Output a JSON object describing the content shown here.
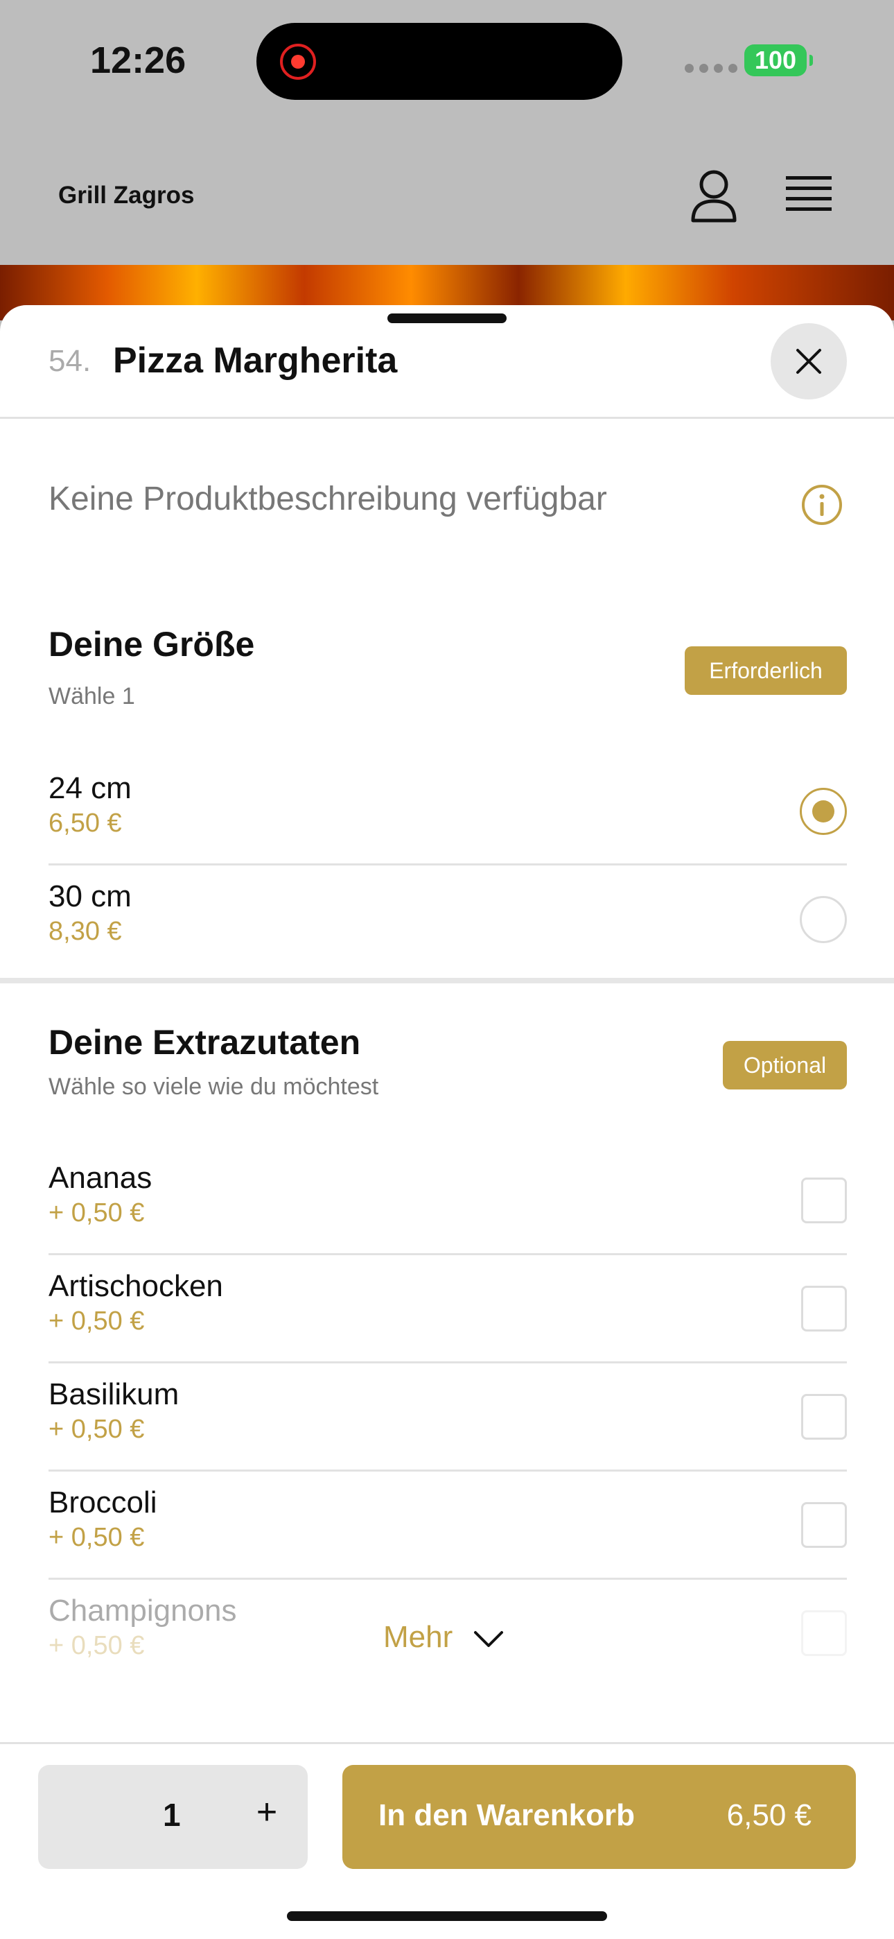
{
  "status_bar": {
    "time": "12:26",
    "battery": "100"
  },
  "header": {
    "brand": "Grill Zagros"
  },
  "product": {
    "number": "54.",
    "title": "Pizza Margherita",
    "description": "Keine Produktbeschreibung verfügbar"
  },
  "size_section": {
    "title": "Deine Größe",
    "subtitle": "Wähle 1",
    "badge": "Erforderlich",
    "options": [
      {
        "name": "24 cm",
        "price": "6,50 €",
        "selected": true
      },
      {
        "name": "30 cm",
        "price": "8,30 €",
        "selected": false
      }
    ]
  },
  "extras_section": {
    "title": "Deine Extrazutaten",
    "subtitle": "Wähle so viele wie du möchtest",
    "badge": "Optional",
    "options": [
      {
        "name": "Ananas",
        "price": "+ 0,50 €"
      },
      {
        "name": "Artischocken",
        "price": "+ 0,50 €"
      },
      {
        "name": "Basilikum",
        "price": "+ 0,50 €"
      },
      {
        "name": "Broccoli",
        "price": "+ 0,50 €"
      },
      {
        "name": "Champignons",
        "price": "+ 0,50 €"
      }
    ],
    "more_label": "Mehr"
  },
  "footer": {
    "quantity": "1",
    "plus": "+",
    "cart_label": "In den Warenkorb",
    "cart_price": "6,50 €"
  },
  "colors": {
    "accent": "#c2a146",
    "overlay": "#bdbdbd",
    "battery": "#34c759"
  },
  "icons": [
    "user-icon",
    "menu-icon",
    "close-icon",
    "info-icon",
    "chevron-down-icon"
  ]
}
